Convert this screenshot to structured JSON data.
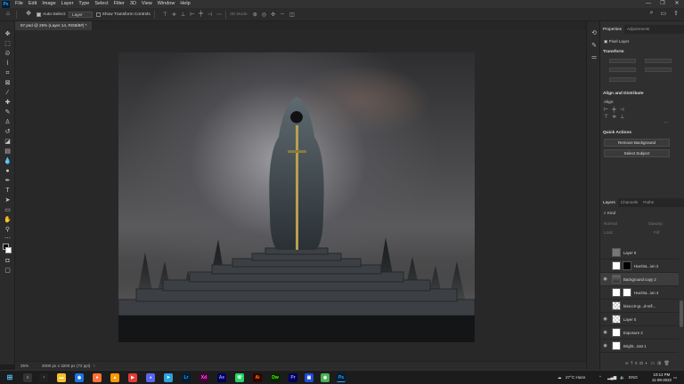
{
  "menu": [
    "File",
    "Edit",
    "Image",
    "Layer",
    "Type",
    "Select",
    "Filter",
    "3D",
    "View",
    "Window",
    "Help"
  ],
  "window_controls": [
    "—",
    "❐",
    "✕"
  ],
  "options": {
    "auto_select_label": "Auto-Select:",
    "auto_select_value": "Layer",
    "show_transform_label": "Show Transform Controls",
    "mode_label": "3D Mode:"
  },
  "document_tab": "87.psd @ 25% (Layer 14, RGB/8#) *",
  "status": {
    "zoom": "25%",
    "size": "4000 px x 3200 px (72 ppi)",
    "arrow": "›"
  },
  "properties": {
    "tabs": [
      "Properties",
      "Adjustments"
    ],
    "layer_kind": "Pixel Layer",
    "transform_head": "Transform",
    "align_head": "Align and Distribute",
    "align_label": "Align:",
    "quick_head": "Quick Actions",
    "remove_bg": "Remove Background",
    "select_subject": "Select Subject",
    "more": "..."
  },
  "layers_panel": {
    "tabs": [
      "Layers",
      "Channels",
      "Paths"
    ],
    "kind_label": "Kind",
    "mode_label": "Normal",
    "opacity_label": "Opacity:",
    "lock_label": "Lock:",
    "fill_label": "Fill:",
    "rows": [
      {
        "name": "Layer 8",
        "thumb": "gray",
        "visible": false
      },
      {
        "name": "Hue/Sa...ion 2",
        "thumb": "black",
        "visible": false
      },
      {
        "name": "Background copy 2",
        "thumb": "photo",
        "visible": true
      },
      {
        "name": "Hue/Sa...ion 4",
        "thumb": "white",
        "visible": false
      },
      {
        "name": "kisscc0-gr...d-refl...",
        "thumb": "check",
        "visible": false
      },
      {
        "name": "Layer 5",
        "thumb": "check",
        "visible": true
      },
      {
        "name": "Exposure 2",
        "thumb": "white",
        "visible": true
      },
      {
        "name": "Bright...rast 1",
        "thumb": "white",
        "visible": true
      }
    ]
  },
  "taskbar": {
    "weather": "27°C  Haze",
    "lang": "ENG",
    "time": "10:14 PM",
    "date": "11-08-2022"
  }
}
